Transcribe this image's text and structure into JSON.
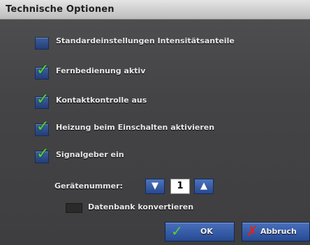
{
  "window": {
    "title": "Technische Optionen"
  },
  "options": [
    {
      "label": "Standardeinstellungen Intensitätsanteile",
      "checked": false
    },
    {
      "label": "Fernbedienung aktiv",
      "checked": true
    },
    {
      "label": "Kontaktkontrolle aus",
      "checked": true
    },
    {
      "label": "Heizung beim Einschalten aktivieren",
      "checked": true
    },
    {
      "label": "Signalgeber ein",
      "checked": true
    }
  ],
  "device": {
    "label": "Gerätenummer:",
    "value": "1",
    "down_icon": "arrow-down-icon",
    "up_icon": "arrow-up-icon"
  },
  "database": {
    "label": "Datenbank konvertieren",
    "checked": false
  },
  "buttons": {
    "ok_label": "OK",
    "cancel_label": "Abbruch",
    "ok_icon": "check-icon",
    "cancel_icon": "cross-icon"
  },
  "colors": {
    "accent": "#2c4d94",
    "check": "#4fd43a",
    "cancel_icon": "#e2231a"
  }
}
